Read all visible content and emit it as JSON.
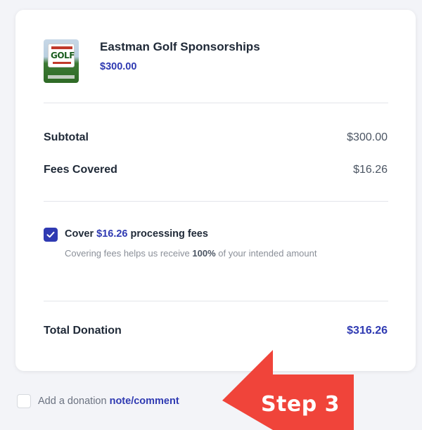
{
  "item": {
    "thumbnail_icon": "golf-event-thumbnail",
    "thumbnail_text": "GOLF",
    "name": "Eastman Golf Sponsorships",
    "price": "$300.00"
  },
  "summary": {
    "subtotal_label": "Subtotal",
    "subtotal_value": "$300.00",
    "fees_label": "Fees Covered",
    "fees_value": "$16.26"
  },
  "cover_fees": {
    "checked": true,
    "prefix": "Cover ",
    "amount": "$16.26",
    "suffix": " processing fees",
    "desc_prefix": "Covering fees helps us receive ",
    "desc_bold": "100%",
    "desc_suffix": " of your intended amount"
  },
  "total": {
    "label": "Total Donation",
    "value": "$316.26"
  },
  "note": {
    "checked": false,
    "prefix": "Add a donation ",
    "link": "note/comment"
  },
  "annotation": {
    "label": "Step 3",
    "color": "#f0443a"
  },
  "colors": {
    "accent": "#2f3ab2",
    "background": "#f3f4f8"
  }
}
